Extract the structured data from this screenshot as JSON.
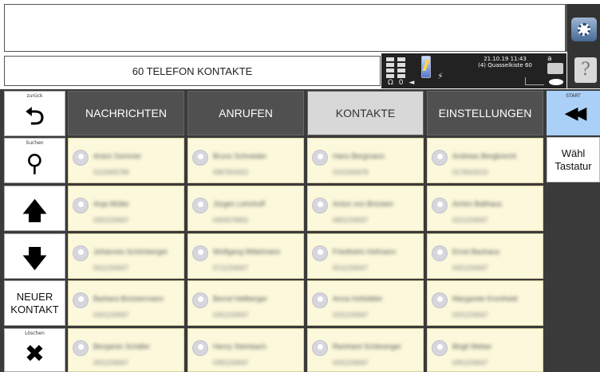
{
  "header": {
    "title": "60 TELEFON KONTAKTE",
    "datetime": "21.10.19 11:43",
    "status_line": "(4) Quasselkiste 60",
    "signal_icons": "Ω 0 ◄",
    "indicator_a": "a"
  },
  "side": {
    "back_caption": "zurück",
    "back_icon": "⮌",
    "search_caption": "Suchen",
    "search_icon": "⚲",
    "up_icon": "🡅",
    "down_icon": "🡇",
    "new_contact_label": "NEUER KONTAKT",
    "delete_caption": "Löschen",
    "delete_icon": "✖"
  },
  "tabs": [
    {
      "label": "NACHRICHTEN",
      "active": false
    },
    {
      "label": "ANRUFEN",
      "active": false
    },
    {
      "label": "KONTAKTE",
      "active": true
    },
    {
      "label": "EINSTELLUNGEN",
      "active": false
    }
  ],
  "right": {
    "start_caption": "START",
    "start_icon": "◀◀",
    "wahl_label": "Wähl Tastatur",
    "help_label": "?"
  },
  "contacts": [
    {
      "name": "Anton Sommer",
      "number": "0123456789"
    },
    {
      "name": "Bruno Schneider",
      "number": "0987654321"
    },
    {
      "name": "Hans Bergmann",
      "number": "0152345678"
    },
    {
      "name": "Andreas Bergbrecht",
      "number": "0176543210"
    },
    {
      "name": "Anja Müller",
      "number": "0301234567"
    },
    {
      "name": "Jürgen Lehnhoff",
      "number": "0405678901"
    },
    {
      "name": "Anton von Brücken",
      "number": "0891234567"
    },
    {
      "name": "Achim Ballhaus",
      "number": "0221234567"
    },
    {
      "name": "Johannes Schönberger",
      "number": "0611234567"
    },
    {
      "name": "Wolfgang Mittelmann",
      "number": "0711234567"
    },
    {
      "name": "Friedhelm Hofmann",
      "number": "0511234567"
    },
    {
      "name": "Ernst Bauhaus",
      "number": "0421234567"
    },
    {
      "name": "Barbara Brückermann",
      "number": "0341234567"
    },
    {
      "name": "Bernd Hellberger",
      "number": "0351234567"
    },
    {
      "name": "Anna Hofstätter",
      "number": "0231234567"
    },
    {
      "name": "Margarete Kroniheld",
      "number": "0201234567"
    },
    {
      "name": "Benjamin Schäfer",
      "number": "0911234567"
    },
    {
      "name": "Henry Steinbach",
      "number": "0391234567"
    },
    {
      "name": "Reinhard Schlesinger",
      "number": "0431234567"
    },
    {
      "name": "Birgit Weber",
      "number": "0451234567"
    }
  ]
}
